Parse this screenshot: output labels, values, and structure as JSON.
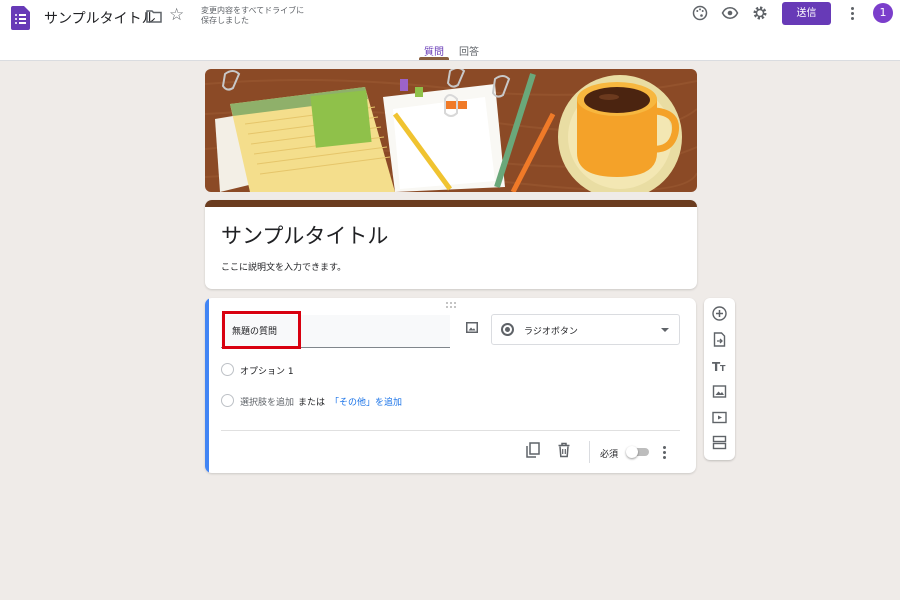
{
  "header": {
    "doc_title": "サンプルタイトル",
    "save_status_line1": "変更内容をすべてドライブに",
    "save_status_line2": "保存しました",
    "send_label": "送信",
    "avatar_initial": "1",
    "icons": [
      "palette-icon",
      "eye-icon",
      "gear-icon",
      "more-vert-icon"
    ]
  },
  "tabs": [
    {
      "label": "質問",
      "active": true
    },
    {
      "label": "回答",
      "active": false
    }
  ],
  "form": {
    "title": "サンプルタイトル",
    "description": "ここに説明文を入力できます。"
  },
  "question": {
    "title": "無題の質問",
    "type_label": "ラジオボタン",
    "option1": "オプション 1",
    "add_option": "選択肢を追加",
    "or_text": "または",
    "add_other": "「その他」を追加",
    "required_label": "必須",
    "required_on": false
  },
  "side_toolbar": [
    "add-question-icon",
    "import-questions-icon",
    "add-title-icon",
    "add-image-icon",
    "add-video-icon",
    "add-section-icon"
  ],
  "colors": {
    "accent": "#673ab7",
    "background": "#efebe8",
    "header_bar": "#6b3c1f",
    "question_bar": "#4285f4",
    "highlight": "#d8000f",
    "link": "#1a73e8"
  }
}
